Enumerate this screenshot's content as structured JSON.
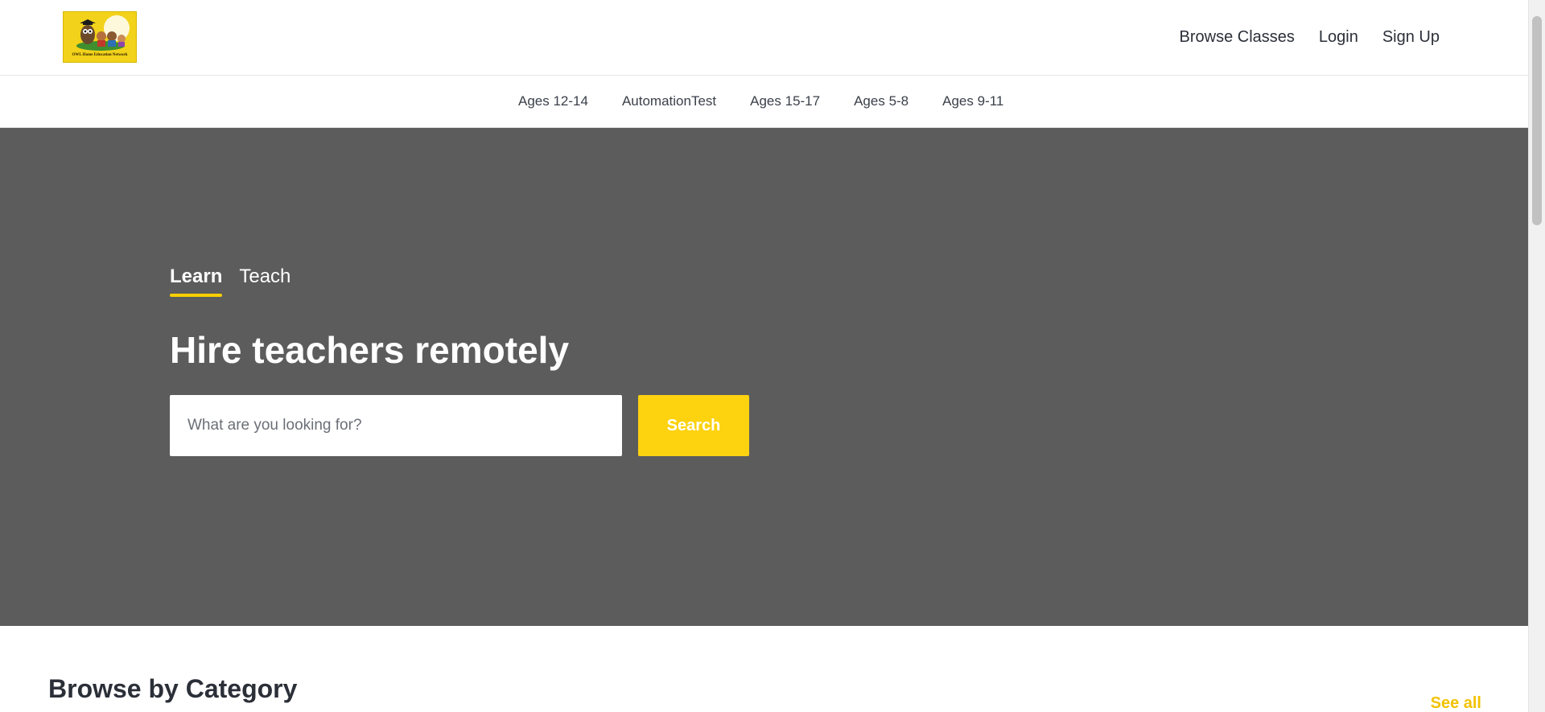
{
  "brand": {
    "logo_text": "OWL Home Education Network",
    "logo_bg_color": "#f2d21a"
  },
  "header": {
    "nav": [
      {
        "label": "Browse Classes"
      },
      {
        "label": "Login"
      },
      {
        "label": "Sign Up"
      }
    ]
  },
  "categories": [
    {
      "label": "Ages 12-14"
    },
    {
      "label": "AutomationTest"
    },
    {
      "label": "Ages 15-17"
    },
    {
      "label": "Ages 5-8"
    },
    {
      "label": "Ages 9-11"
    }
  ],
  "hero": {
    "tabs": [
      {
        "label": "Learn",
        "active": true
      },
      {
        "label": "Teach",
        "active": false
      }
    ],
    "title": "Hire teachers remotely",
    "search_placeholder": "What are you looking for?",
    "search_value": "",
    "search_button": "Search",
    "background_color": "#5c5c5c",
    "accent_color": "#fdd20f"
  },
  "browse": {
    "title": "Browse by Category",
    "see_all": "See all"
  },
  "icons": {
    "logo": "owl-family-logo-image"
  }
}
